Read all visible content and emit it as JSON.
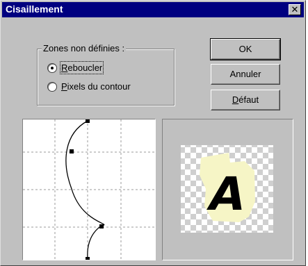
{
  "window": {
    "title": "Cisaillement"
  },
  "titlebar": {
    "close_glyph": "✕"
  },
  "group": {
    "label": "Zones non définies :",
    "options": [
      {
        "mnemonic": "R",
        "rest": "eboucler",
        "selected": true
      },
      {
        "mnemonic": "P",
        "rest": "ixels du contour",
        "selected": false
      }
    ]
  },
  "buttons": {
    "ok": "OK",
    "annuler": "Annuler",
    "defaut_mnemonic": "D",
    "defaut_rest": "éfaut"
  },
  "preview": {
    "letter": "A"
  },
  "colors": {
    "titlebar": "#000080",
    "dialog_bg": "#c0c0c0",
    "preview_page": "#f6f5c6"
  }
}
